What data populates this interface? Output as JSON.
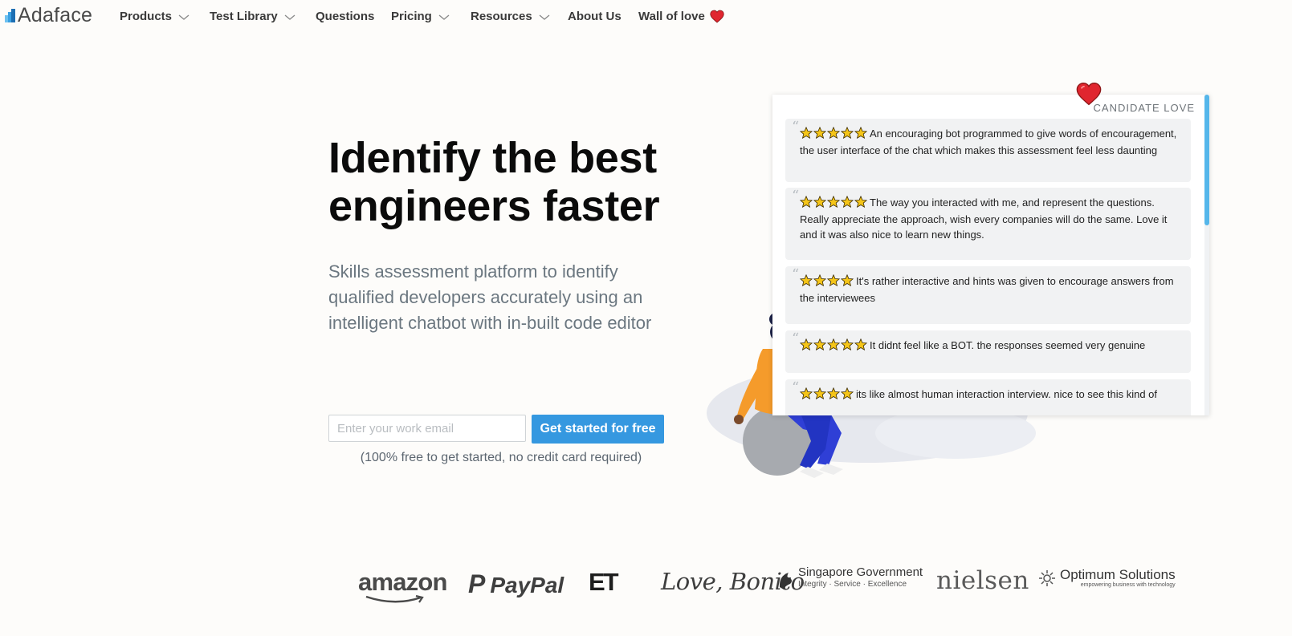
{
  "nav": {
    "logo": "Adaface",
    "items": [
      {
        "label": "Products",
        "has_dropdown": true
      },
      {
        "label": "Test Library",
        "has_dropdown": true
      },
      {
        "label": "Questions",
        "has_dropdown": false
      },
      {
        "label": "Pricing",
        "has_dropdown": true
      },
      {
        "label": "Resources",
        "has_dropdown": true
      },
      {
        "label": "About Us",
        "has_dropdown": false
      },
      {
        "label": "Wall of love",
        "has_dropdown": false,
        "icon": "heart-icon"
      }
    ]
  },
  "hero": {
    "title": "Identify the best engineers faster",
    "subtitle": "Skills assessment platform to identify qualified developers accurately using an intelligent chatbot with in-built code editor",
    "email_placeholder": "Enter your work email",
    "cta_label": "Get started for free",
    "note": "(100% free to get started, no credit card required)"
  },
  "testimonials": {
    "label": "CANDIDATE LOVE",
    "reviews": [
      {
        "stars": 5,
        "text": "An encouraging bot programmed to give words of encouragement, the user interface of the chat which makes this assessment feel less daunting"
      },
      {
        "stars": 5,
        "text": "The way you interacted with me, and represent the questions. Really appreciate the approach, wish every companies will do the same. Love it and it was also nice to learn new things."
      },
      {
        "stars": 4,
        "text": "It's rather interactive and hints was given to encourage answers from the interviewees"
      },
      {
        "stars": 5,
        "text": "It didnt feel like a BOT. the responses seemed very genuine"
      },
      {
        "stars": 4,
        "text": "its like almost human interaction interview. nice to see this kind of"
      }
    ]
  },
  "logos": {
    "amazon": "amazon",
    "paypal": "PayPal",
    "et": "ET",
    "lovebonito": "Love, Bonito",
    "sg_name": "Singapore Government",
    "sg_tag": "Integrity · Service · Excellence",
    "nielsen": "nielsen",
    "optimum_name": "Optimum Solutions",
    "optimum_tag": "empowering business with technology"
  },
  "colors": {
    "accent": "#3598e0",
    "heart": "#e0262f",
    "star": "#f5c518",
    "background": "#fdfcfa"
  }
}
